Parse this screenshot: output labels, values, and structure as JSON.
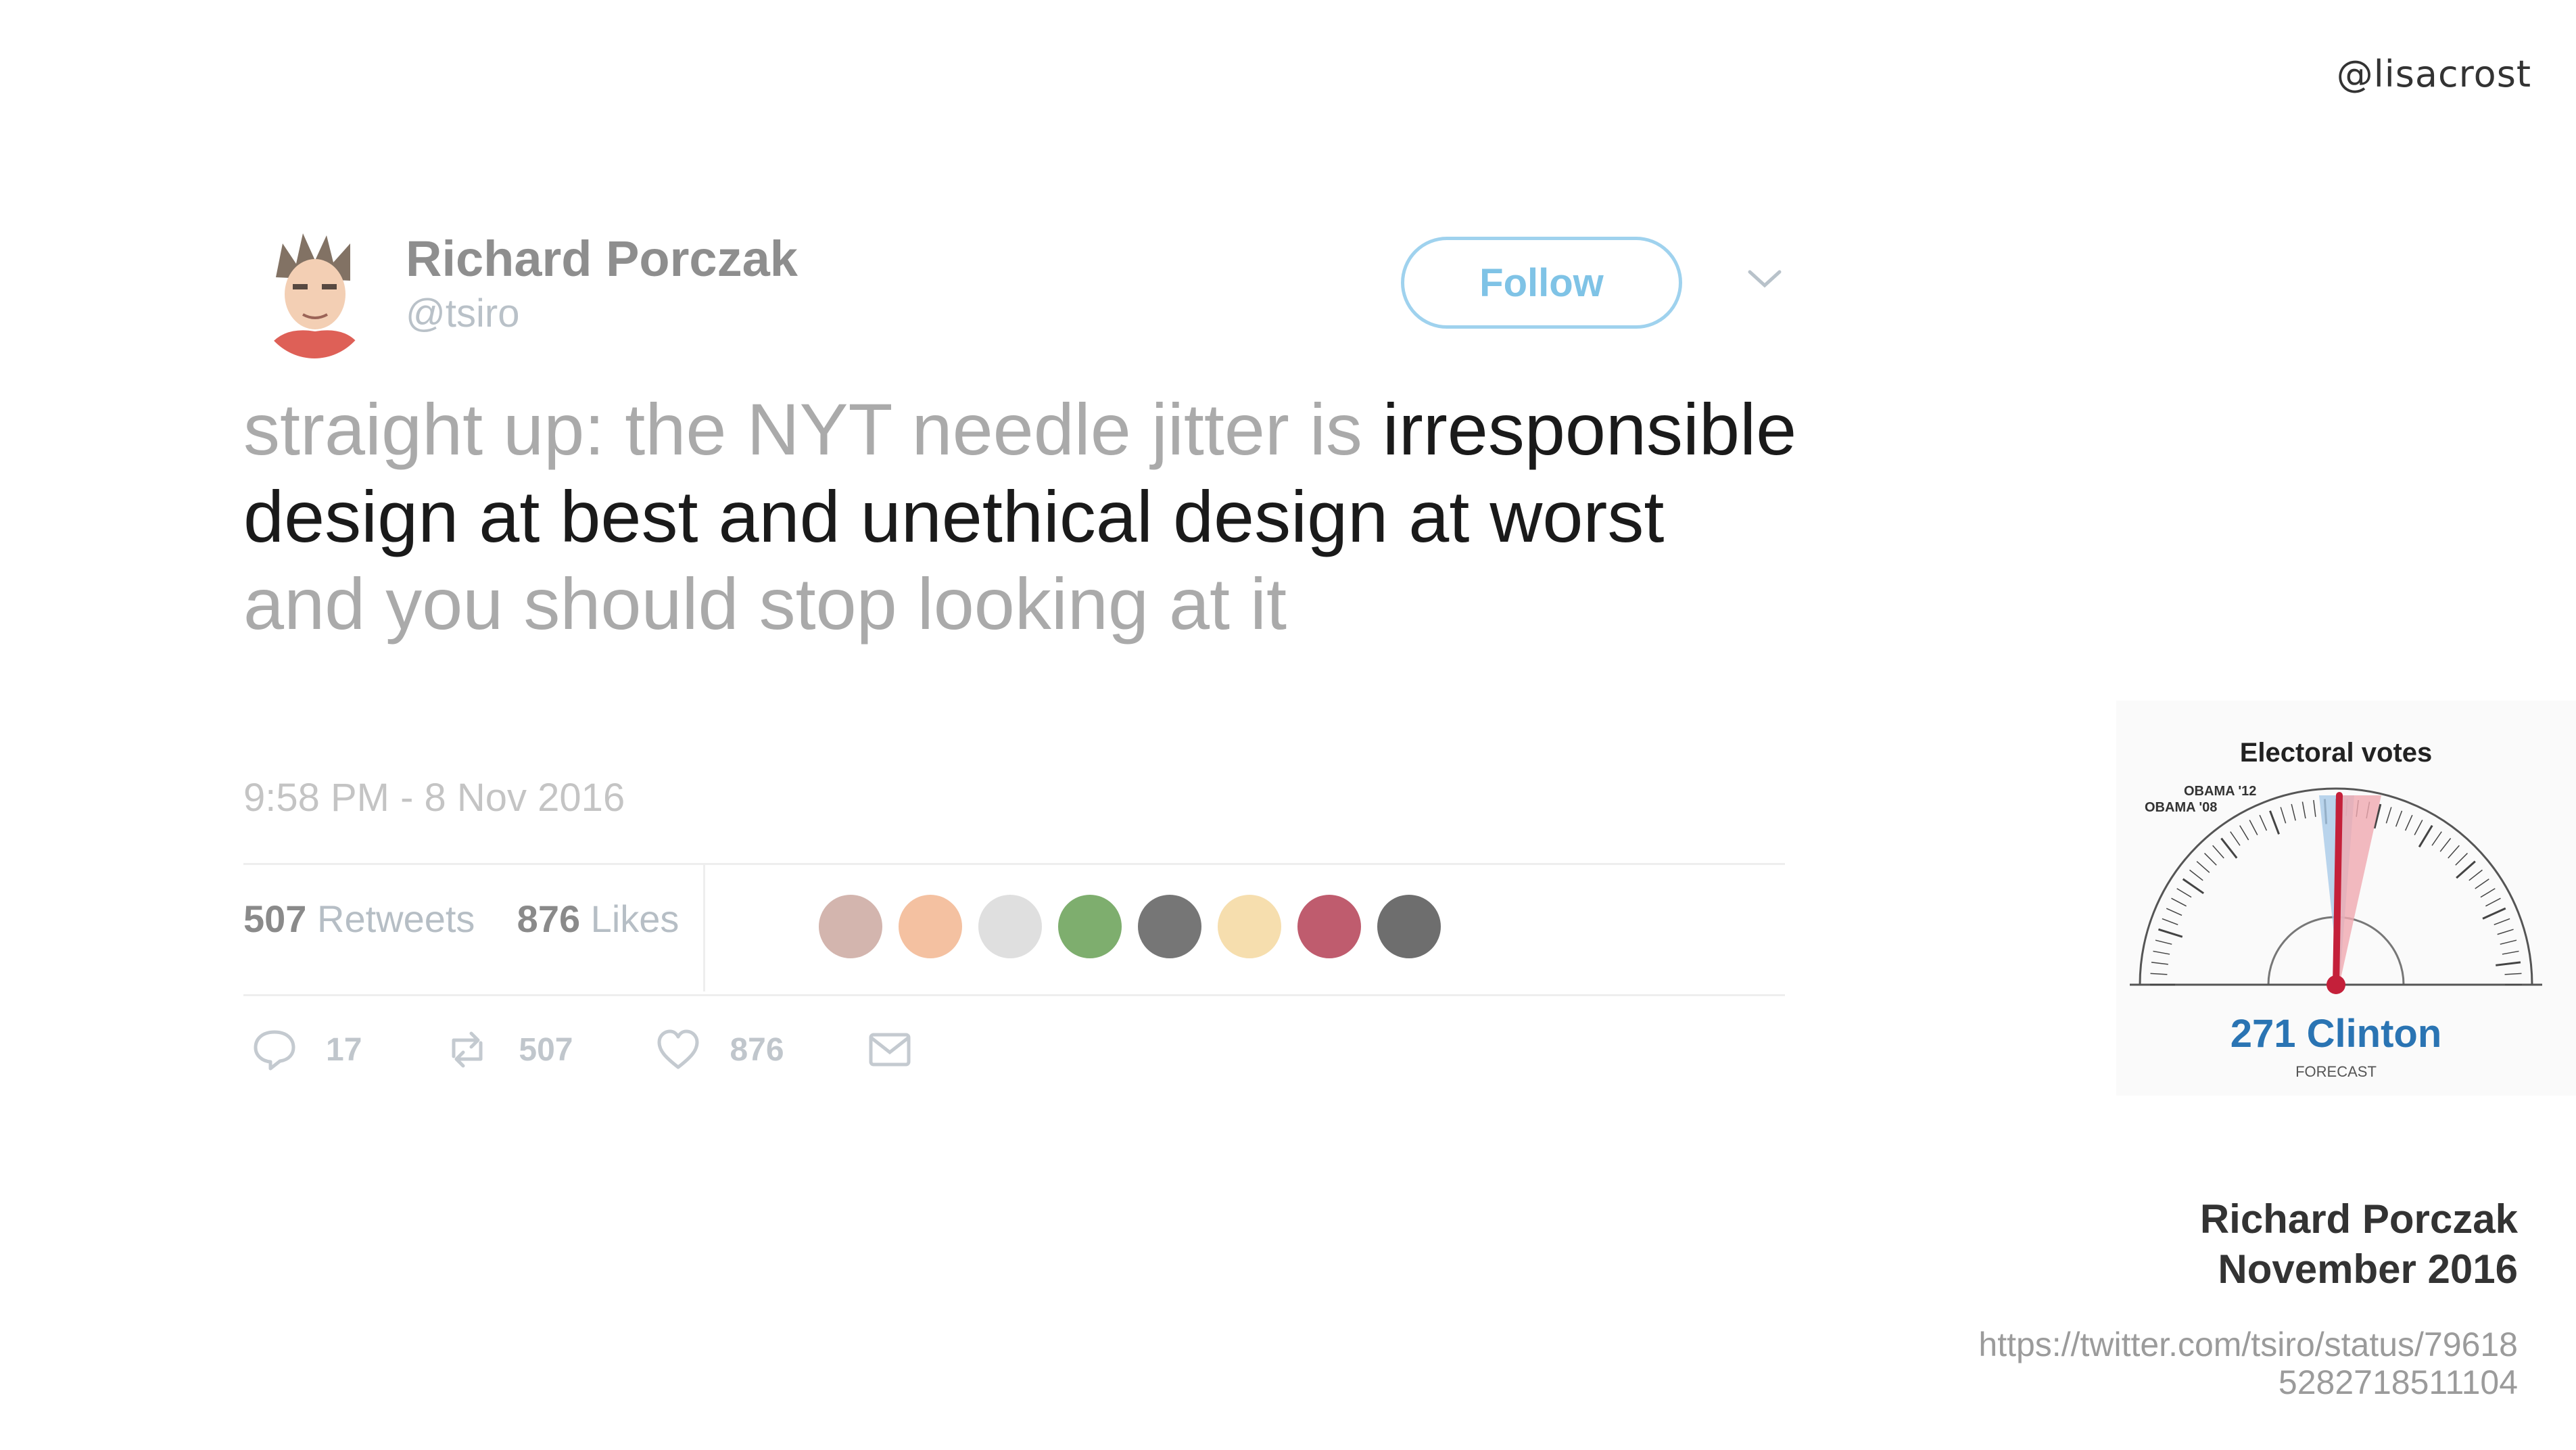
{
  "corner_handle": "@lisacrost",
  "tweet": {
    "name": "Richard Porczak",
    "handle": "@tsiro",
    "follow_label": "Follow",
    "text_parts": {
      "lead": "straight up: the NYT needle jitter is",
      "strong": "irresponsible design at best and unethical design at worst",
      "tail": "and you should stop looking at it"
    },
    "timestamp": "9:58 PM - 8 Nov 2016",
    "stats": {
      "retweets_count": "507",
      "retweets_label": "Retweets",
      "likes_count": "876",
      "likes_label": "Likes"
    },
    "actions": {
      "reply_count": "17",
      "retweet_count": "507",
      "like_count": "876"
    },
    "icons": [
      "reply-icon",
      "retweet-icon",
      "heart-icon",
      "mail-icon",
      "chevron-down-icon"
    ],
    "colors": {
      "follow_border": "#9fd2ee",
      "follow_text": "#7fc3e6"
    }
  },
  "needle_graphic": {
    "title": "Electoral votes",
    "label_obama12": "OBAMA '12",
    "label_obama08": "OBAMA '08",
    "forecast_value": "271 Clinton",
    "forecast_label": "FORECAST",
    "colors": {
      "needle": "#d0304a",
      "forecast": "#2a74b3"
    }
  },
  "attribution": {
    "name": "Richard Porczak",
    "date": "November 2016",
    "url": "https://twitter.com/tsiro/status/796185282718511104"
  }
}
